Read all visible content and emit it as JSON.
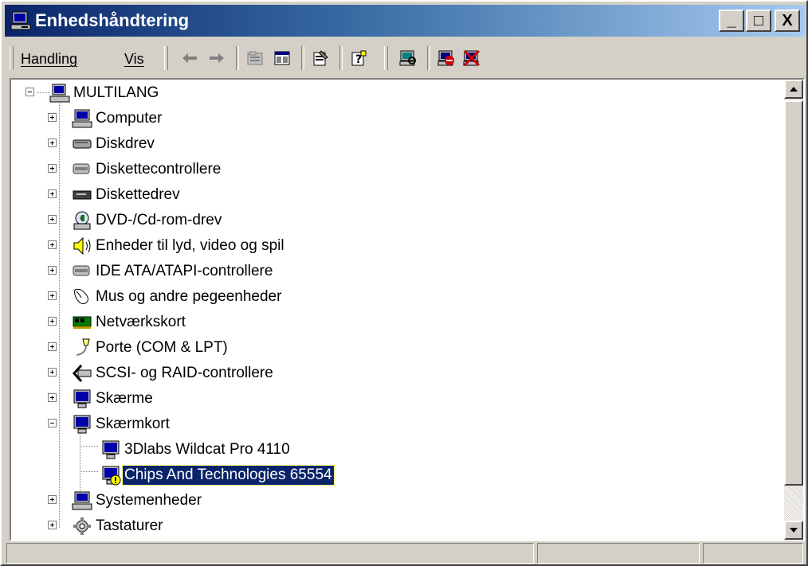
{
  "window": {
    "title": "Enhedshåndtering",
    "controls": {
      "minimize": "_",
      "maximize": "□",
      "close": "X"
    }
  },
  "menu": [
    "Handling",
    "Vis"
  ],
  "toolbar": {
    "icons": [
      "back-arrow-icon",
      "forward-arrow-icon",
      "folder-view-icon",
      "list-view-icon",
      "properties-icon",
      "help-icon",
      "scan-hardware-icon",
      "uninstall-icon",
      "disable-icon"
    ]
  },
  "tree": {
    "root": "MULTILANG",
    "categories": [
      {
        "label": "Computer",
        "icon": "computer-icon",
        "expanded": false
      },
      {
        "label": "Diskdrev",
        "icon": "disk-drive-icon",
        "expanded": false
      },
      {
        "label": "Diskettecontrollere",
        "icon": "floppy-controller-icon",
        "expanded": false
      },
      {
        "label": "Diskettedrev",
        "icon": "floppy-drive-icon",
        "expanded": false
      },
      {
        "label": "DVD-/Cd-rom-drev",
        "icon": "cdrom-icon",
        "expanded": false
      },
      {
        "label": "Enheder til lyd, video og spil",
        "icon": "speaker-icon",
        "expanded": false
      },
      {
        "label": "IDE ATA/ATAPI-controllere",
        "icon": "ide-controller-icon",
        "expanded": false
      },
      {
        "label": "Mus og andre pegeenheder",
        "icon": "mouse-icon",
        "expanded": false
      },
      {
        "label": "Netværkskort",
        "icon": "network-card-icon",
        "expanded": false
      },
      {
        "label": "Porte (COM & LPT)",
        "icon": "port-icon",
        "expanded": false
      },
      {
        "label": "SCSI- og RAID-controllere",
        "icon": "scsi-icon",
        "expanded": false
      },
      {
        "label": "Skærme",
        "icon": "monitor-icon",
        "expanded": false
      },
      {
        "label": "Skærmkort",
        "icon": "monitor-icon",
        "expanded": true,
        "children": [
          {
            "label": "3Dlabs Wildcat Pro 4110",
            "icon": "monitor-icon",
            "selected": false
          },
          {
            "label": "Chips And Technologies 65554",
            "icon": "monitor-warning-icon",
            "selected": true
          }
        ]
      },
      {
        "label": "Systemenheder",
        "icon": "computer-icon",
        "expanded": false
      },
      {
        "label": "Tastaturer",
        "icon": "keyboard-icon",
        "expanded": false
      }
    ]
  },
  "colors": {
    "selection": "#0a246a",
    "titlebar_start": "#0a246a",
    "titlebar_end": "#a6caf0",
    "face": "#d4d0c8"
  }
}
